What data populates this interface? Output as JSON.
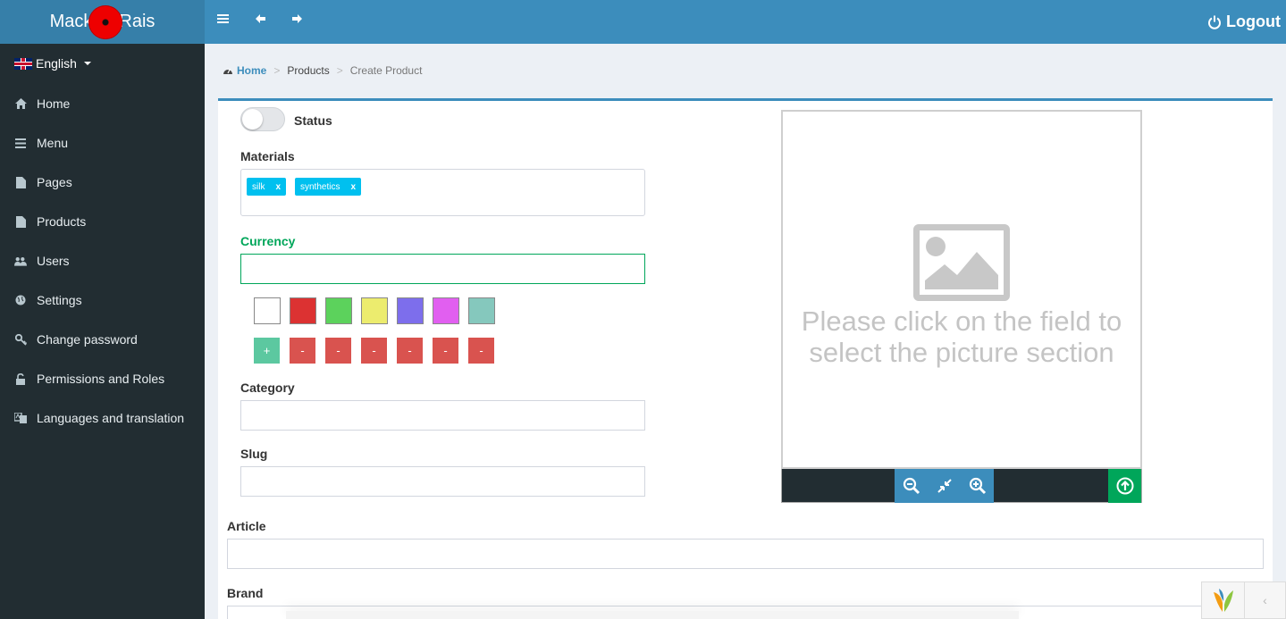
{
  "brand": {
    "left": "Mack",
    "right": "Rais"
  },
  "topbar": {
    "logout_label": "Logout"
  },
  "sidebar": {
    "language": "English",
    "items": [
      {
        "label": "Home",
        "icon": "home-icon"
      },
      {
        "label": "Menu",
        "icon": "bars-icon"
      },
      {
        "label": "Pages",
        "icon": "file-icon"
      },
      {
        "label": "Products",
        "icon": "file-icon"
      },
      {
        "label": "Users",
        "icon": "users-icon"
      },
      {
        "label": "Settings",
        "icon": "globe-icon"
      },
      {
        "label": "Change password",
        "icon": "key-icon"
      },
      {
        "label": "Permissions and Roles",
        "icon": "unlock-icon"
      },
      {
        "label": "Languages and translation",
        "icon": "translate-icon"
      }
    ]
  },
  "breadcrumb": {
    "home": "Home",
    "products": "Products",
    "current": "Create Product",
    "sep": ">"
  },
  "form": {
    "status_label": "Status",
    "status_on": false,
    "materials_label": "Materials",
    "materials": [
      {
        "label": "silk",
        "remove": "x"
      },
      {
        "label": "synthetics",
        "remove": "x"
      }
    ],
    "currency_label": "Currency",
    "currency_value": "",
    "colors": [
      "#ffffff",
      "#dc3232",
      "#5cd25c",
      "#ecec6e",
      "#7d6eec",
      "#e15ff0",
      "#85c8bd"
    ],
    "add_label": "+",
    "remove_label": "-",
    "category_label": "Category",
    "slug_label": "Slug",
    "article_label": "Article",
    "brand_label": "Brand"
  },
  "picker": {
    "placeholder": "Please click on the field to select the picture section"
  }
}
